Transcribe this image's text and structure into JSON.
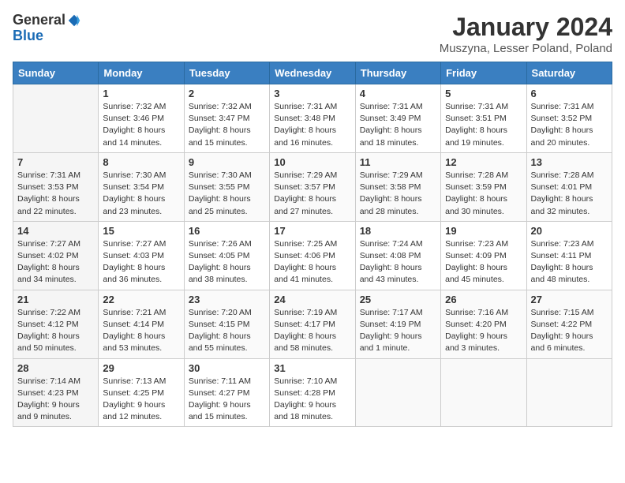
{
  "logo": {
    "general": "General",
    "blue": "Blue"
  },
  "title": "January 2024",
  "subtitle": "Muszyna, Lesser Poland, Poland",
  "days_of_week": [
    "Sunday",
    "Monday",
    "Tuesday",
    "Wednesday",
    "Thursday",
    "Friday",
    "Saturday"
  ],
  "weeks": [
    [
      {
        "day": "",
        "info": ""
      },
      {
        "day": "1",
        "info": "Sunrise: 7:32 AM\nSunset: 3:46 PM\nDaylight: 8 hours\nand 14 minutes."
      },
      {
        "day": "2",
        "info": "Sunrise: 7:32 AM\nSunset: 3:47 PM\nDaylight: 8 hours\nand 15 minutes."
      },
      {
        "day": "3",
        "info": "Sunrise: 7:31 AM\nSunset: 3:48 PM\nDaylight: 8 hours\nand 16 minutes."
      },
      {
        "day": "4",
        "info": "Sunrise: 7:31 AM\nSunset: 3:49 PM\nDaylight: 8 hours\nand 18 minutes."
      },
      {
        "day": "5",
        "info": "Sunrise: 7:31 AM\nSunset: 3:51 PM\nDaylight: 8 hours\nand 19 minutes."
      },
      {
        "day": "6",
        "info": "Sunrise: 7:31 AM\nSunset: 3:52 PM\nDaylight: 8 hours\nand 20 minutes."
      }
    ],
    [
      {
        "day": "7",
        "info": "Sunrise: 7:31 AM\nSunset: 3:53 PM\nDaylight: 8 hours\nand 22 minutes."
      },
      {
        "day": "8",
        "info": "Sunrise: 7:30 AM\nSunset: 3:54 PM\nDaylight: 8 hours\nand 23 minutes."
      },
      {
        "day": "9",
        "info": "Sunrise: 7:30 AM\nSunset: 3:55 PM\nDaylight: 8 hours\nand 25 minutes."
      },
      {
        "day": "10",
        "info": "Sunrise: 7:29 AM\nSunset: 3:57 PM\nDaylight: 8 hours\nand 27 minutes."
      },
      {
        "day": "11",
        "info": "Sunrise: 7:29 AM\nSunset: 3:58 PM\nDaylight: 8 hours\nand 28 minutes."
      },
      {
        "day": "12",
        "info": "Sunrise: 7:28 AM\nSunset: 3:59 PM\nDaylight: 8 hours\nand 30 minutes."
      },
      {
        "day": "13",
        "info": "Sunrise: 7:28 AM\nSunset: 4:01 PM\nDaylight: 8 hours\nand 32 minutes."
      }
    ],
    [
      {
        "day": "14",
        "info": "Sunrise: 7:27 AM\nSunset: 4:02 PM\nDaylight: 8 hours\nand 34 minutes."
      },
      {
        "day": "15",
        "info": "Sunrise: 7:27 AM\nSunset: 4:03 PM\nDaylight: 8 hours\nand 36 minutes."
      },
      {
        "day": "16",
        "info": "Sunrise: 7:26 AM\nSunset: 4:05 PM\nDaylight: 8 hours\nand 38 minutes."
      },
      {
        "day": "17",
        "info": "Sunrise: 7:25 AM\nSunset: 4:06 PM\nDaylight: 8 hours\nand 41 minutes."
      },
      {
        "day": "18",
        "info": "Sunrise: 7:24 AM\nSunset: 4:08 PM\nDaylight: 8 hours\nand 43 minutes."
      },
      {
        "day": "19",
        "info": "Sunrise: 7:23 AM\nSunset: 4:09 PM\nDaylight: 8 hours\nand 45 minutes."
      },
      {
        "day": "20",
        "info": "Sunrise: 7:23 AM\nSunset: 4:11 PM\nDaylight: 8 hours\nand 48 minutes."
      }
    ],
    [
      {
        "day": "21",
        "info": "Sunrise: 7:22 AM\nSunset: 4:12 PM\nDaylight: 8 hours\nand 50 minutes."
      },
      {
        "day": "22",
        "info": "Sunrise: 7:21 AM\nSunset: 4:14 PM\nDaylight: 8 hours\nand 53 minutes."
      },
      {
        "day": "23",
        "info": "Sunrise: 7:20 AM\nSunset: 4:15 PM\nDaylight: 8 hours\nand 55 minutes."
      },
      {
        "day": "24",
        "info": "Sunrise: 7:19 AM\nSunset: 4:17 PM\nDaylight: 8 hours\nand 58 minutes."
      },
      {
        "day": "25",
        "info": "Sunrise: 7:17 AM\nSunset: 4:19 PM\nDaylight: 9 hours\nand 1 minute."
      },
      {
        "day": "26",
        "info": "Sunrise: 7:16 AM\nSunset: 4:20 PM\nDaylight: 9 hours\nand 3 minutes."
      },
      {
        "day": "27",
        "info": "Sunrise: 7:15 AM\nSunset: 4:22 PM\nDaylight: 9 hours\nand 6 minutes."
      }
    ],
    [
      {
        "day": "28",
        "info": "Sunrise: 7:14 AM\nSunset: 4:23 PM\nDaylight: 9 hours\nand 9 minutes."
      },
      {
        "day": "29",
        "info": "Sunrise: 7:13 AM\nSunset: 4:25 PM\nDaylight: 9 hours\nand 12 minutes."
      },
      {
        "day": "30",
        "info": "Sunrise: 7:11 AM\nSunset: 4:27 PM\nDaylight: 9 hours\nand 15 minutes."
      },
      {
        "day": "31",
        "info": "Sunrise: 7:10 AM\nSunset: 4:28 PM\nDaylight: 9 hours\nand 18 minutes."
      },
      {
        "day": "",
        "info": ""
      },
      {
        "day": "",
        "info": ""
      },
      {
        "day": "",
        "info": ""
      }
    ]
  ]
}
